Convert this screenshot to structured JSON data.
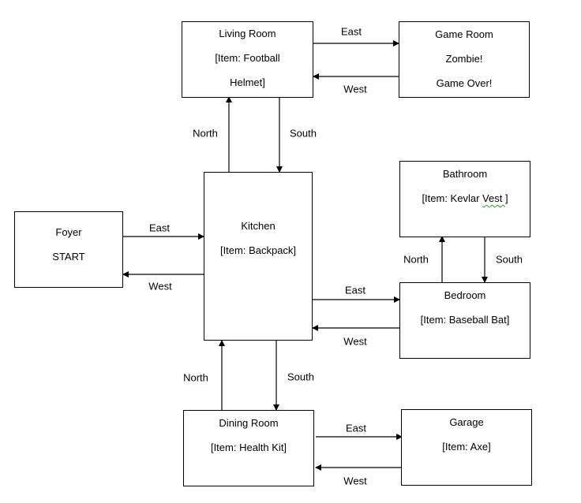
{
  "rooms": {
    "living_room": {
      "name": "Living Room",
      "lines": [
        "[Item: Football",
        "Helmet]"
      ]
    },
    "game_room": {
      "name": "Game Room",
      "lines": [
        "Zombie!",
        "Game Over!"
      ]
    },
    "foyer": {
      "name": "Foyer",
      "lines": [
        "START"
      ]
    },
    "kitchen": {
      "name": "Kitchen",
      "lines": [
        "[Item: Backpack]"
      ]
    },
    "bathroom": {
      "name": "Bathroom",
      "item_prefix": "[Item: Kevlar ",
      "item_flagged": "Vest ",
      "item_suffix": "]"
    },
    "bedroom": {
      "name": "Bedroom",
      "lines": [
        "[Item: Baseball Bat]"
      ]
    },
    "dining_room": {
      "name": "Dining Room",
      "lines": [
        "[Item: Health Kit]"
      ]
    },
    "garage": {
      "name": "Garage",
      "lines": [
        "[Item: Axe]"
      ]
    }
  },
  "connections": {
    "living_game_east": "East",
    "game_living_west": "West",
    "kitchen_living_north": "North",
    "living_kitchen_south": "South",
    "foyer_kitchen_east": "East",
    "kitchen_foyer_west": "West",
    "bedroom_bathroom_north": "North",
    "bathroom_bedroom_south": "South",
    "kitchen_bedroom_east": "East",
    "bedroom_kitchen_west": "West",
    "dining_kitchen_north": "North",
    "kitchen_dining_south": "South",
    "dining_garage_east": "East",
    "garage_dining_west": "West"
  }
}
